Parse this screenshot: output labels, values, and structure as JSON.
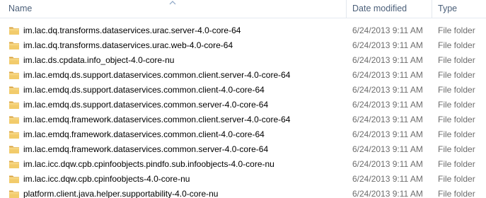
{
  "header": {
    "name_label": "Name",
    "date_label": "Date modified",
    "type_label": "Type"
  },
  "colors": {
    "header_text": "#4c607a",
    "folder_yellow": "#e8b84a",
    "secondary_text": "#6d6d6d"
  },
  "rows": [
    {
      "name": "im.lac.dq.transforms.dataservices.urac.server-4.0-core-64",
      "date": "6/24/2013 9:11 AM",
      "type": "File folder"
    },
    {
      "name": "im.lac.dq.transforms.dataservices.urac.web-4.0-core-64",
      "date": "6/24/2013 9:11 AM",
      "type": "File folder"
    },
    {
      "name": "im.lac.ds.cpdata.info_object-4.0-core-nu",
      "date": "6/24/2013 9:11 AM",
      "type": "File folder"
    },
    {
      "name": "im.lac.emdq.ds.support.dataservices.common.client.server-4.0-core-64",
      "date": "6/24/2013 9:11 AM",
      "type": "File folder"
    },
    {
      "name": "im.lac.emdq.ds.support.dataservices.common.client-4.0-core-64",
      "date": "6/24/2013 9:11 AM",
      "type": "File folder"
    },
    {
      "name": "im.lac.emdq.ds.support.dataservices.common.server-4.0-core-64",
      "date": "6/24/2013 9:11 AM",
      "type": "File folder"
    },
    {
      "name": "im.lac.emdq.framework.dataservices.common.client.server-4.0-core-64",
      "date": "6/24/2013 9:11 AM",
      "type": "File folder"
    },
    {
      "name": "im.lac.emdq.framework.dataservices.common.client-4.0-core-64",
      "date": "6/24/2013 9:11 AM",
      "type": "File folder"
    },
    {
      "name": "im.lac.emdq.framework.dataservices.common.server-4.0-core-64",
      "date": "6/24/2013 9:11 AM",
      "type": "File folder"
    },
    {
      "name": "im.lac.icc.dqw.cpb.cpinfoobjects.pindfo.sub.infoobjects-4.0-core-nu",
      "date": "6/24/2013 9:11 AM",
      "type": "File folder"
    },
    {
      "name": "im.lac.icc.dqw.cpb.cpinfoobjects-4.0-core-nu",
      "date": "6/24/2013 9:11 AM",
      "type": "File folder"
    },
    {
      "name": "platform.client.java.helper.supportability-4.0-core-nu",
      "date": "6/24/2013 9:11 AM",
      "type": "File folder"
    }
  ]
}
